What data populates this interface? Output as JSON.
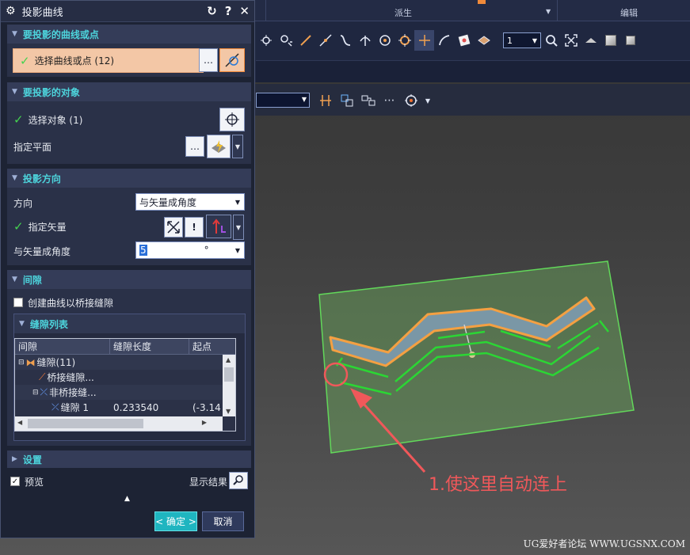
{
  "ribbon": {
    "groups": [
      "派生",
      "编辑"
    ],
    "layer_value": "1"
  },
  "dialog": {
    "title": "投影曲线",
    "sections": {
      "curves": {
        "header": "要投影的曲线或点",
        "select_label": "选择曲线或点 (12)"
      },
      "objects": {
        "header": "要投影的对象",
        "select_label": "选择对象 (1)",
        "plane_label": "指定平面"
      },
      "direction": {
        "header": "投影方向",
        "direction_label": "方向",
        "direction_value": "与矢量成角度",
        "vector_label": "指定矢量",
        "angle_label": "与矢量成角度",
        "angle_value": "5",
        "angle_unit": "°"
      },
      "gap": {
        "header": "间隙",
        "bridge_checkbox_label": "创建曲线以桥接缝隙",
        "list_header": "缝隙列表",
        "columns": [
          "间隙",
          "缝隙长度",
          "起点"
        ],
        "rows": [
          {
            "name": "缝隙(11)",
            "length": "",
            "start": ""
          },
          {
            "name": "桥接缝隙...",
            "length": "",
            "start": ""
          },
          {
            "name": "非桥接缝...",
            "length": "",
            "start": ""
          },
          {
            "name": "缝隙 1",
            "length": "0.233540",
            "start": "(-3.14"
          }
        ]
      },
      "settings": {
        "header": "设置"
      }
    },
    "preview_label": "预览",
    "show_result_label": "显示结果",
    "ok_label": "< 确定 >",
    "cancel_label": "取消"
  },
  "annotation": {
    "text": "1.使这里自动连上"
  },
  "watermark": "UG爱好者论坛 WWW.UGSNX.COM",
  "colors": {
    "accent_teal": "#4dd4dc",
    "selected_row": "#f3c7a6",
    "check_green": "#44d24f",
    "annotation_red": "#f0585a",
    "surface_orange": "#f4a042",
    "curve_green": "#2bd634"
  }
}
